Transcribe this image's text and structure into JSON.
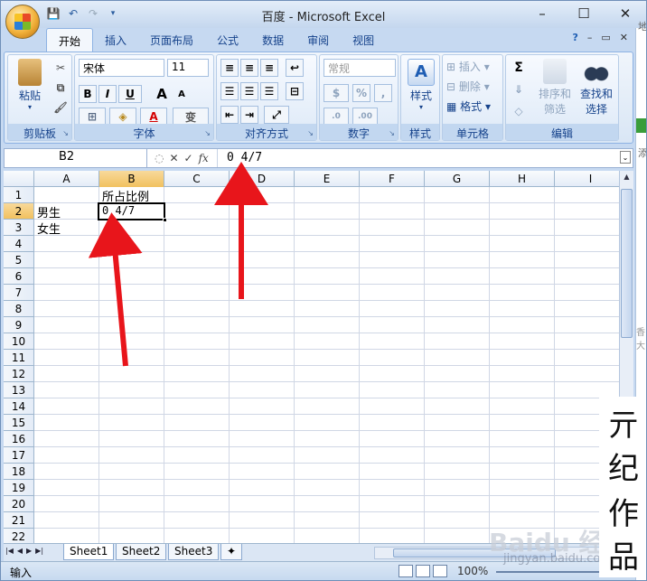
{
  "window": {
    "title": "百度 - Microsoft Excel",
    "controls": [
      "–",
      "☐",
      "✕"
    ]
  },
  "tabs": [
    {
      "label": "开始",
      "active": true
    },
    {
      "label": "插入"
    },
    {
      "label": "页面布局"
    },
    {
      "label": "公式"
    },
    {
      "label": "数据"
    },
    {
      "label": "审阅"
    },
    {
      "label": "视图"
    }
  ],
  "ribbon": {
    "clipboard": {
      "label": "剪贴板",
      "paste": "粘贴"
    },
    "font": {
      "label": "字体",
      "name": "宋体",
      "size": "11",
      "bold": "B",
      "italic": "I",
      "underline": "U",
      "grow": "A",
      "shrink": "A",
      "color_a": "A",
      "wen": "变"
    },
    "alignment": {
      "label": "对齐方式"
    },
    "number": {
      "label": "数字",
      "format": "常规",
      "percent": "%",
      "comma": ","
    },
    "styles": {
      "label": "样式",
      "button": "样式"
    },
    "cells": {
      "label": "单元格",
      "insert": "插入",
      "delete": "删除",
      "format": "格式"
    },
    "editing": {
      "label": "编辑",
      "sum": "Σ",
      "sort1": "排序和",
      "sort2": "筛选",
      "find1": "查找和",
      "find2": "选择"
    }
  },
  "formula_bar": {
    "name_box": "B2",
    "fx": "fx",
    "content": "0 4/7"
  },
  "grid": {
    "columns": [
      "A",
      "B",
      "C",
      "D",
      "E",
      "F",
      "G",
      "H",
      "I"
    ],
    "rows": [
      "1",
      "2",
      "3",
      "4",
      "5",
      "6",
      "7",
      "8",
      "9",
      "10",
      "11",
      "12",
      "13",
      "14",
      "15",
      "16",
      "17",
      "18",
      "19",
      "20",
      "21",
      "22"
    ],
    "cells": {
      "B1": "所占比例",
      "A2": "男生",
      "B2": "0 4/7",
      "A3": "女生"
    },
    "selected": "B2"
  },
  "sheets": [
    "Sheet1",
    "Sheet2",
    "Sheet3"
  ],
  "status": {
    "mode": "输入",
    "zoom": "100%"
  },
  "watermark": {
    "logo": "Baidu 经验",
    "url": "jingyan.baidu.com"
  },
  "signature": [
    "亓",
    "纪",
    "作",
    "品"
  ],
  "side_panel": {
    "text1": "地",
    "text2": "添",
    "text3": "香大"
  },
  "colors": {
    "accent": "#15428b",
    "arrow": "#e8151b",
    "selection": "#f1c15f"
  }
}
